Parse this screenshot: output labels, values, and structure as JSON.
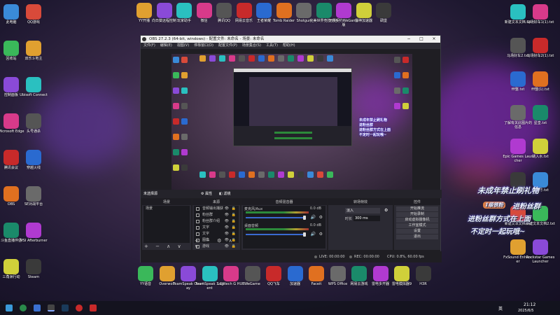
{
  "desktop": {
    "left_icons": [
      "此电脑",
      "QQ游戏",
      "回收站",
      "双乐斗地主",
      "控制面板",
      "Ubisoft Connect",
      "Microsoft Edge",
      "头号通杀",
      "腾讯会议",
      "穿越火线",
      "OBS",
      "SE对战平台",
      "斗鱼直播伴侣",
      "MSI Afterburner",
      "三角洲行动",
      "Steam"
    ],
    "top_icons": [
      "YY开播",
      "向日葵远程控制",
      "玩家助手",
      "微信",
      "腾讯QQ",
      "网易云音乐",
      "王者荣耀",
      "Tomb Raider",
      "Shotgun",
      "完美世界竞技平台",
      "无畏契约WeGame版",
      "雷神加速器",
      "碉堡"
    ],
    "right_icons": [
      "新建文本文档.txt",
      "马场好车1(1).txt",
      "马场好车2.txt",
      "马场好车2(1).txt",
      "fff整.txt",
      "fff整(1).txt",
      "了解有关此图片的信息",
      "星皇.txt",
      "Epic Games Launcher",
      "跳入水.txt",
      "零秀",
      "fff整号.txt",
      "新建文本文档.txt",
      "新建文本文档2.txt",
      "FxSound Enhancer",
      "Rockstar Games Launcher"
    ],
    "bottom_icons": [
      "YY语音",
      "Overwolf",
      "TeamSpeak Overlay",
      "TeamSpeak 3 Client",
      "Logitech G HUB",
      "WeGame",
      "QQ飞车",
      "加速器",
      "Faceit",
      "WPS Office",
      "网易云游戏",
      "雷电多开器",
      "雷电模拟器9",
      "H3R"
    ],
    "promo_lines": [
      "未成年禁止刷礼物",
      "进粉丝群",
      "进粉丝群方式在上面",
      "不定时一起玩哦~"
    ],
    "promo_badge": "1级铁粉"
  },
  "obs": {
    "title": "OBS 27.2.3 (64-bit, windows) - 配置文件: 未命名 - 场景: 未命名",
    "menu": [
      "文件(F)",
      "编辑(E)",
      "视图(V)",
      "停靠窗口(D)",
      "配置文件(P)",
      "场景集合(S)",
      "工具(T)",
      "帮助(H)"
    ],
    "controlbar": {
      "label": "未选择源",
      "props": "属性",
      "filters": "滤镜"
    },
    "panels": {
      "scenes": "场景",
      "sources": "来源",
      "mixer": "音频混音器",
      "transitions": "转场特效",
      "controls": "控件"
    },
    "scene_items": [
      "场景"
    ],
    "source_items": [
      "音频输出捕获",
      "粉丝群",
      "粉丝群介绍",
      "文字",
      "文字",
      "图像",
      "游戏"
    ],
    "mixer": [
      {
        "name": "麦克风/Aux",
        "db": "0.0 dB"
      },
      {
        "name": "桌面音频",
        "db": "0.0 dB"
      }
    ],
    "transition": {
      "type": "淡入",
      "duration_label": "时长",
      "duration": "300 ms"
    },
    "controls": [
      "开始推流",
      "开始录制",
      "启动虚拟摄像机",
      "工作室模式",
      "设置",
      "退出"
    ],
    "status": {
      "live": "LIVE: 00:00:00",
      "rec": "REC: 00:00:00",
      "cpu": "CPU: 0.8%, 60.00 fps"
    }
  },
  "taskbar": {
    "time": "21:12",
    "date": "2025/6/5",
    "lang": "英"
  }
}
